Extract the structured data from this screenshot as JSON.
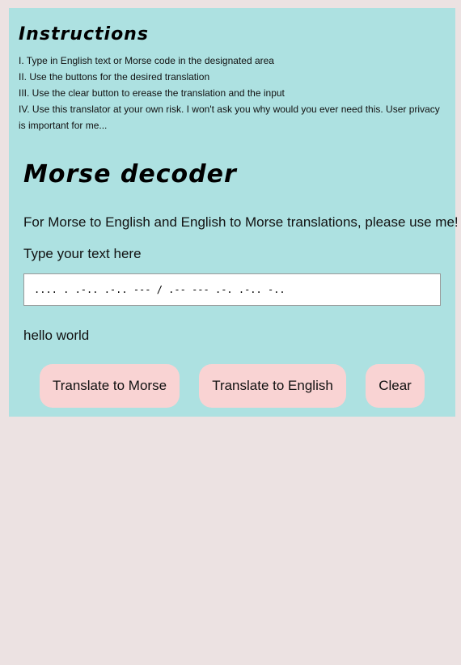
{
  "instructions": {
    "title": "Instructions",
    "items": [
      "I. Type in English text or Morse code in the designated area",
      "II. Use the buttons for the desired translation",
      "III. Use the clear button to erease the translation and the input",
      "IV. Use this translator at your own risk. I won't ask you why would you ever need this. User privacy is important for me..."
    ]
  },
  "decoder": {
    "title": "Morse decoder",
    "subtitle": "For Morse to English and English to Morse translations, please use me!",
    "input_label": "Type your text here",
    "input_value": ".... . .-.. .-.. --- / .-- --- .-. .-.. -..",
    "output": "hello world"
  },
  "buttons": {
    "to_morse": "Translate to Morse",
    "to_english": "Translate to English",
    "clear": "Clear"
  },
  "colors": {
    "background": "#ece2e2",
    "panel": "#ade1e1",
    "button": "#f9d3d3"
  }
}
